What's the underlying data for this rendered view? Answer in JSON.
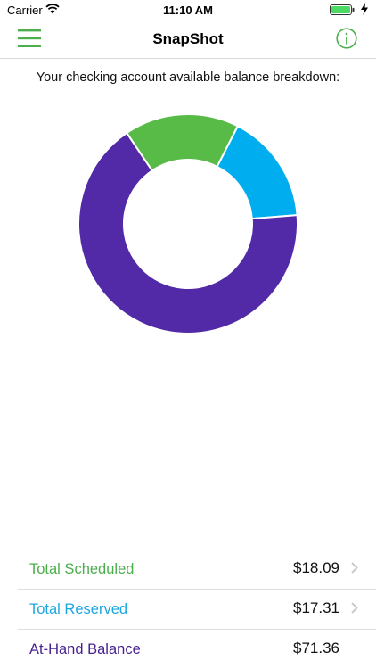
{
  "status_bar": {
    "carrier": "Carrier",
    "time": "11:10 AM",
    "battery_level": 1.0
  },
  "nav": {
    "title": "SnapShot",
    "accent_color": "#4cae4c"
  },
  "subtitle": "Your checking account available balance breakdown:",
  "chart_data": {
    "type": "pie",
    "variant": "donut",
    "categories": [
      "Total Scheduled",
      "Total Reserved",
      "At-Hand Balance"
    ],
    "values": [
      18.09,
      17.31,
      71.36
    ],
    "colors": [
      "#58bb47",
      "#00adef",
      "#5229a6"
    ],
    "start_angle_deg": -34
  },
  "summary": {
    "rows": [
      {
        "label": "Total Scheduled",
        "value": "$18.09",
        "color": "#4cae4c",
        "has_chevron": true
      },
      {
        "label": "Total Reserved",
        "value": "$17.31",
        "color": "#1ea7df",
        "has_chevron": true
      },
      {
        "label": "At-Hand Balance",
        "value": "$71.36",
        "color": "#4a2390",
        "has_chevron": false
      }
    ]
  }
}
